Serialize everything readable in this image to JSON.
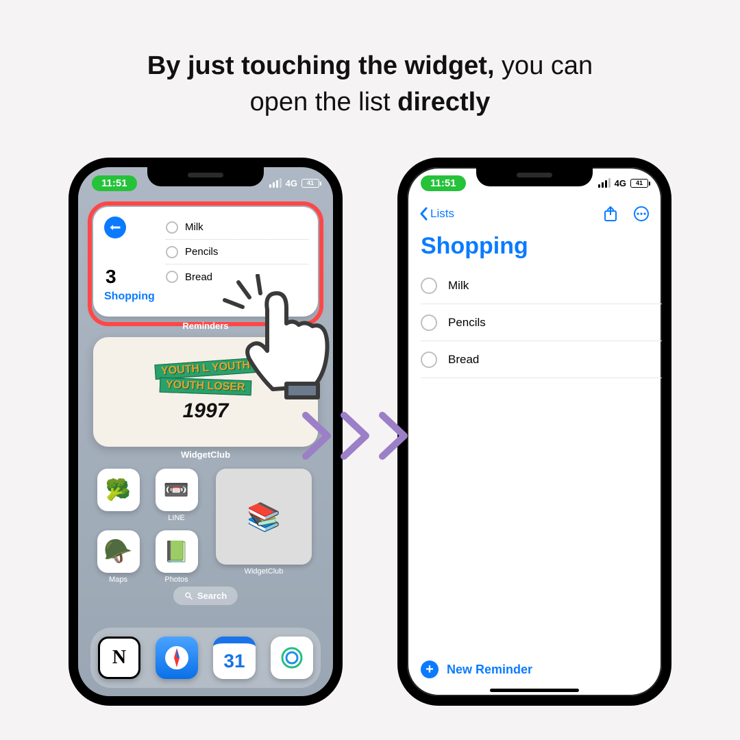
{
  "headline": {
    "b1": "By just touching the widget,",
    "r1": " you can",
    "r2": "open the list ",
    "b2": "directly"
  },
  "status": {
    "time": "11:51",
    "net": "4G",
    "batt": "41"
  },
  "left": {
    "widget": {
      "count": "3",
      "listName": "Shopping",
      "items": [
        "Milk",
        "Pencils",
        "Bread"
      ],
      "caption": "Reminders"
    },
    "art": {
      "tape1": "YOUTH L  YOUTH",
      "tape2": "YOUTH LOSER",
      "year": "1997",
      "caption": "WidgetClub"
    },
    "apps": {
      "a1": "",
      "a2": "LINE",
      "a3": "Maps",
      "a4": "Photos",
      "medium": "WidgetClub"
    },
    "search": "Search",
    "dock": {
      "d1": "N",
      "d2": "",
      "d3": "31",
      "d4": ""
    }
  },
  "right": {
    "back": "Lists",
    "title": "Shopping",
    "items": [
      "Milk",
      "Pencils",
      "Bread"
    ],
    "newReminder": "New Reminder"
  }
}
